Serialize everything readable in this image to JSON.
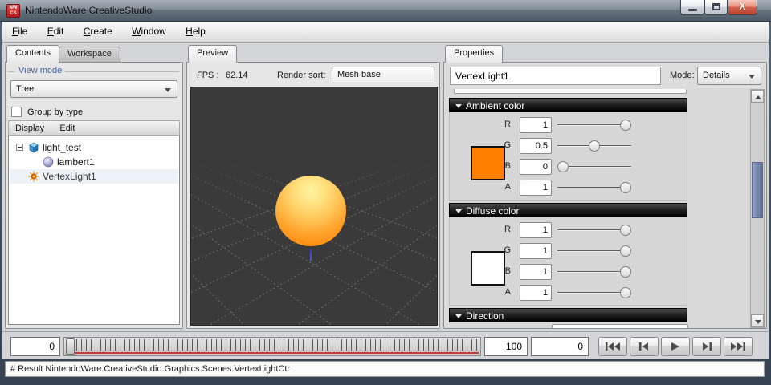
{
  "window": {
    "title": "NintendoWare CreativeStudio",
    "logo": {
      "top": "NW",
      "bottom": "CS"
    }
  },
  "menu_bar": {
    "items": [
      {
        "mnemonic": "F",
        "rest": "ile"
      },
      {
        "mnemonic": "E",
        "rest": "dit"
      },
      {
        "mnemonic": "C",
        "rest": "reate"
      },
      {
        "mnemonic": "W",
        "rest": "indow"
      },
      {
        "mnemonic": "H",
        "rest": "elp"
      }
    ]
  },
  "left_panel": {
    "tabs": [
      {
        "label": "Contents",
        "active": true
      },
      {
        "label": "Workspace",
        "active": false
      }
    ],
    "view_mode": {
      "group_label": "View mode",
      "value": "Tree"
    },
    "group_by_type": {
      "label": "Group by type",
      "checked": false
    },
    "tree_toolbar": {
      "items": [
        {
          "label": "Display"
        },
        {
          "label": "Edit"
        }
      ]
    },
    "tree": [
      {
        "label": "light_test",
        "icon": "cube-icon",
        "expanded": true,
        "depth": 0,
        "selected": false
      },
      {
        "label": "lambert1",
        "icon": "material-sphere-icon",
        "depth": 1,
        "selected": false
      },
      {
        "label": "VertexLight1",
        "icon": "vertex-light-icon",
        "depth": 0,
        "selected": true
      }
    ]
  },
  "preview_panel": {
    "tab": "Preview",
    "fps_label": "FPS :",
    "fps_value": "62.14",
    "render_sort_label": "Render sort:",
    "render_sort_value": "Mesh base"
  },
  "properties_panel": {
    "tab": "Properties",
    "name_value": "VertexLight1",
    "mode_label": "Mode:",
    "mode_value": "Details",
    "sections": [
      {
        "title": "Ambient color",
        "swatch_color": "#ff8000",
        "channels": [
          {
            "label": "R",
            "value": "1",
            "fraction": 1
          },
          {
            "label": "G",
            "value": "0.5",
            "fraction": 0.5
          },
          {
            "label": "B",
            "value": "0",
            "fraction": 0
          },
          {
            "label": "A",
            "value": "1",
            "fraction": 1
          }
        ]
      },
      {
        "title": "Diffuse color",
        "swatch_color": "#ffffff",
        "channels": [
          {
            "label": "R",
            "value": "1",
            "fraction": 1
          },
          {
            "label": "G",
            "value": "1",
            "fraction": 1
          },
          {
            "label": "B",
            "value": "1",
            "fraction": 1
          },
          {
            "label": "A",
            "value": "1",
            "fraction": 1
          }
        ]
      },
      {
        "title": "Direction"
      }
    ]
  },
  "timeline": {
    "start_value": "0",
    "end_value": "100",
    "current_value": "0",
    "buttons": [
      "skip-to-start",
      "step-back",
      "play",
      "step-forward",
      "skip-to-end"
    ]
  },
  "status_bar": {
    "text": "# Result NintendoWare.CreativeStudio.Graphics.Scenes.VertexLightCtr"
  },
  "colors": {
    "ambient_swatch": "#ff8000",
    "diffuse_swatch": "#ffffff",
    "section_header": "#000000",
    "viewport_background": "#3a3a3a",
    "sphere_top": "#fff3a0",
    "sphere_bottom": "#ff8b0c",
    "scrollbar_thumb": "#7587ab",
    "timeline_marker_red": "#c43b3b",
    "logo_red": "#c12222"
  }
}
